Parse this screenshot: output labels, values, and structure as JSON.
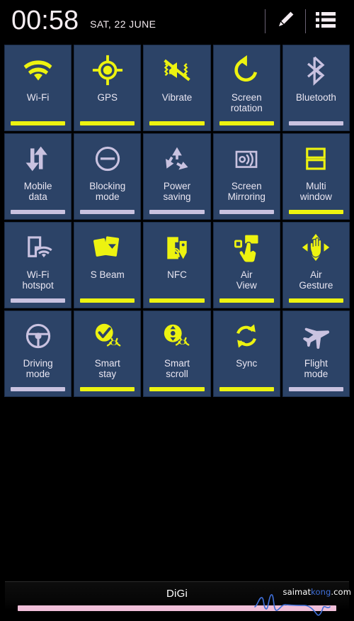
{
  "header": {
    "time": "00:58",
    "date": "SAT, 22 JUNE",
    "edit_icon": "pencil-icon",
    "list_icon": "list-icon"
  },
  "theme": {
    "tile_bg": "#2c4367",
    "tile_border": "#1d2f4c",
    "active_color": "#edf310",
    "inactive_color": "#c9c2e0",
    "label_color": "#e9e6f2",
    "page_bg": "#000000",
    "slider_color": "#f0bfd9"
  },
  "toggles": {
    "rows": [
      [
        {
          "id": "wifi",
          "label": "Wi-Fi",
          "label_lines": [
            "Wi-Fi"
          ],
          "icon": "wifi-icon",
          "state": "on"
        },
        {
          "id": "gps",
          "label": "GPS",
          "label_lines": [
            "GPS"
          ],
          "icon": "gps-crosshair-icon",
          "state": "on"
        },
        {
          "id": "vibrate",
          "label": "Vibrate",
          "label_lines": [
            "Vibrate"
          ],
          "icon": "vibrate-icon",
          "state": "on"
        },
        {
          "id": "screen-rotation",
          "label": "Screen rotation",
          "label_lines": [
            "Screen",
            "rotation"
          ],
          "icon": "rotate-icon",
          "state": "on"
        },
        {
          "id": "bluetooth",
          "label": "Bluetooth",
          "label_lines": [
            "Bluetooth"
          ],
          "icon": "bluetooth-icon",
          "state": "off"
        }
      ],
      [
        {
          "id": "mobile-data",
          "label": "Mobile data",
          "label_lines": [
            "Mobile",
            "data"
          ],
          "icon": "data-arrows-icon",
          "state": "off"
        },
        {
          "id": "blocking-mode",
          "label": "Blocking mode",
          "label_lines": [
            "Blocking",
            "mode"
          ],
          "icon": "do-not-disturb-icon",
          "state": "off"
        },
        {
          "id": "power-saving",
          "label": "Power saving",
          "label_lines": [
            "Power",
            "saving"
          ],
          "icon": "recycle-icon",
          "state": "off"
        },
        {
          "id": "screen-mirroring",
          "label": "Screen Mirroring",
          "label_lines": [
            "Screen",
            "Mirroring"
          ],
          "icon": "cast-screen-icon",
          "state": "off"
        },
        {
          "id": "multi-window",
          "label": "Multi window",
          "label_lines": [
            "Multi",
            "window"
          ],
          "icon": "multi-window-icon",
          "state": "on"
        }
      ],
      [
        {
          "id": "wifi-hotspot",
          "label": "Wi-Fi hotspot",
          "label_lines": [
            "Wi-Fi",
            "hotspot"
          ],
          "icon": "hotspot-icon",
          "state": "off"
        },
        {
          "id": "s-beam",
          "label": "S Beam",
          "label_lines": [
            "S Beam"
          ],
          "icon": "s-beam-icon",
          "state": "on"
        },
        {
          "id": "nfc",
          "label": "NFC",
          "label_lines": [
            "NFC"
          ],
          "icon": "nfc-icon",
          "state": "on"
        },
        {
          "id": "air-view",
          "label": "Air View",
          "label_lines": [
            "Air",
            "View"
          ],
          "icon": "air-view-icon",
          "state": "on"
        },
        {
          "id": "air-gesture",
          "label": "Air Gesture",
          "label_lines": [
            "Air",
            "Gesture"
          ],
          "icon": "air-gesture-icon",
          "state": "on"
        }
      ],
      [
        {
          "id": "driving-mode",
          "label": "Driving mode",
          "label_lines": [
            "Driving",
            "mode"
          ],
          "icon": "steering-wheel-icon",
          "state": "off"
        },
        {
          "id": "smart-stay",
          "label": "Smart stay",
          "label_lines": [
            "Smart",
            "stay"
          ],
          "icon": "smart-stay-icon",
          "state": "on"
        },
        {
          "id": "smart-scroll",
          "label": "Smart scroll",
          "label_lines": [
            "Smart",
            "scroll"
          ],
          "icon": "smart-scroll-icon",
          "state": "on"
        },
        {
          "id": "sync",
          "label": "Sync",
          "label_lines": [
            "Sync"
          ],
          "icon": "sync-icon",
          "state": "on"
        },
        {
          "id": "flight-mode",
          "label": "Flight mode",
          "label_lines": [
            "Flight",
            "mode"
          ],
          "icon": "airplane-icon",
          "state": "off"
        }
      ]
    ]
  },
  "bottom": {
    "carrier": "DiGi",
    "brightness_percent": 100,
    "watermark_prefix": "saimat",
    "watermark_highlight": "kong",
    "watermark_suffix": ".com"
  }
}
